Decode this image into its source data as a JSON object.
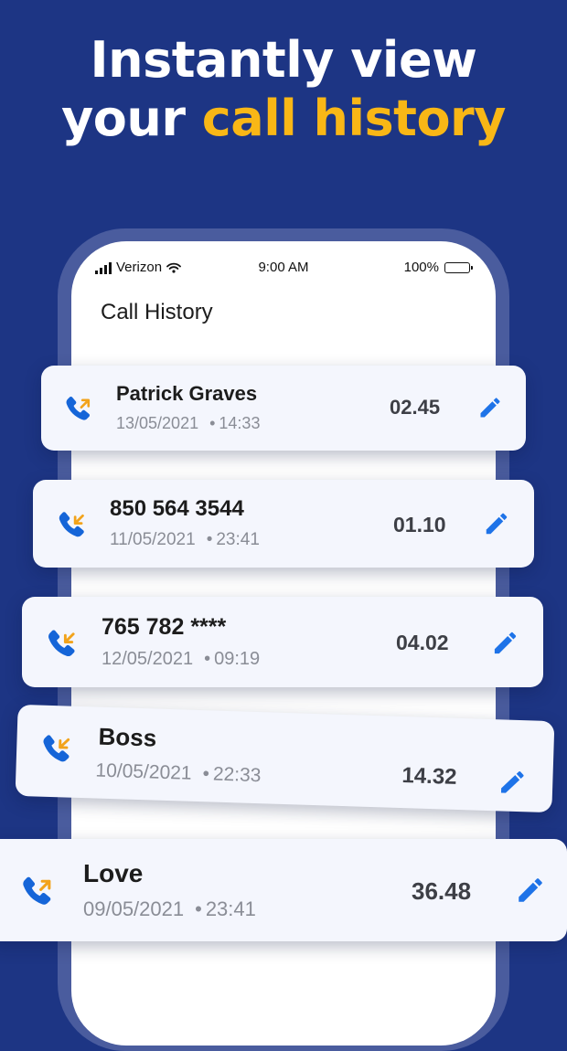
{
  "headline": {
    "line1": "Instantly view",
    "line2_prefix": "your ",
    "line2_accent": "call history"
  },
  "colors": {
    "background": "#1d3584",
    "accent": "#f9b716",
    "phone_icon": "#1565d8",
    "arrow_outgoing": "#f2a31b",
    "arrow_incoming": "#f2a31b",
    "edit_icon": "#1e73e8"
  },
  "status_bar": {
    "carrier": "Verizon",
    "time": "9:00 AM",
    "battery": "100%"
  },
  "screen": {
    "title": "Call History"
  },
  "calls": [
    {
      "name": "Patrick Graves",
      "date": "13/05/2021",
      "time": "14:33",
      "duration": "02.45",
      "direction": "outgoing",
      "icon": "outgoing-call-icon"
    },
    {
      "name": "850 564 3544",
      "date": "11/05/2021",
      "time": "23:41",
      "duration": "01.10",
      "direction": "incoming",
      "icon": "incoming-call-icon"
    },
    {
      "name": "765 782 ****",
      "date": "12/05/2021",
      "time": "09:19",
      "duration": "04.02",
      "direction": "incoming",
      "icon": "incoming-call-icon"
    },
    {
      "name": "Boss",
      "date": "10/05/2021",
      "time": "22:33",
      "duration": "14.32",
      "direction": "incoming",
      "icon": "incoming-call-icon"
    },
    {
      "name": "Love",
      "date": "09/05/2021",
      "time": "23:41",
      "duration": "36.48",
      "direction": "outgoing",
      "icon": "outgoing-call-icon"
    }
  ]
}
